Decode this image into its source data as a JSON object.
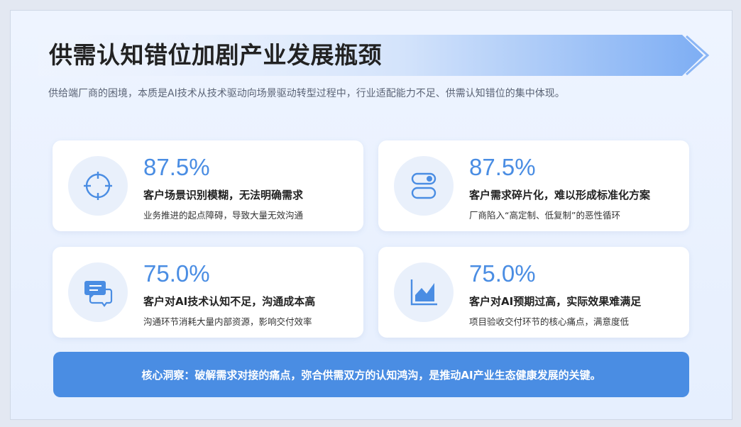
{
  "title": "供需认知错位加剧产业发展瓶颈",
  "subtitle": "供给端厂商的困境，本质是AI技术从技术驱动向场景驱动转型过程中，行业适配能力不足、供需认知错位的集中体现。",
  "colors": {
    "accent": "#4a8de3",
    "banner_start": "#f1f5fd",
    "banner_end": "#8bb6f5",
    "card_bg": "#ffffff",
    "icon_bg": "#e9f0fb"
  },
  "cards": [
    {
      "icon": "crosshair-icon",
      "value": "87.5%",
      "heading": "客户场景识别模糊，无法明确需求",
      "desc": "业务推进的起点障碍，导致大量无效沟通"
    },
    {
      "icon": "config-blocks-icon",
      "value": "87.5%",
      "heading": "客户需求碎片化，难以形成标准化方案",
      "desc": "厂商陷入“高定制、低复制”的恶性循环"
    },
    {
      "icon": "chat-bubbles-icon",
      "value": "75.0%",
      "heading": "客户对AI技术认知不足，沟通成本高",
      "desc": "沟通环节消耗大量内部资源，影响交付效率"
    },
    {
      "icon": "area-chart-icon",
      "value": "75.0%",
      "heading": "客户对AI预期过高，实际效果难满足",
      "desc": "项目验收交付环节的核心痛点，满意度低"
    }
  ],
  "insight": "核心洞察：破解需求对接的痛点，弥合供需双方的认知鸿沟，是推动AI产业生态健康发展的关键。"
}
